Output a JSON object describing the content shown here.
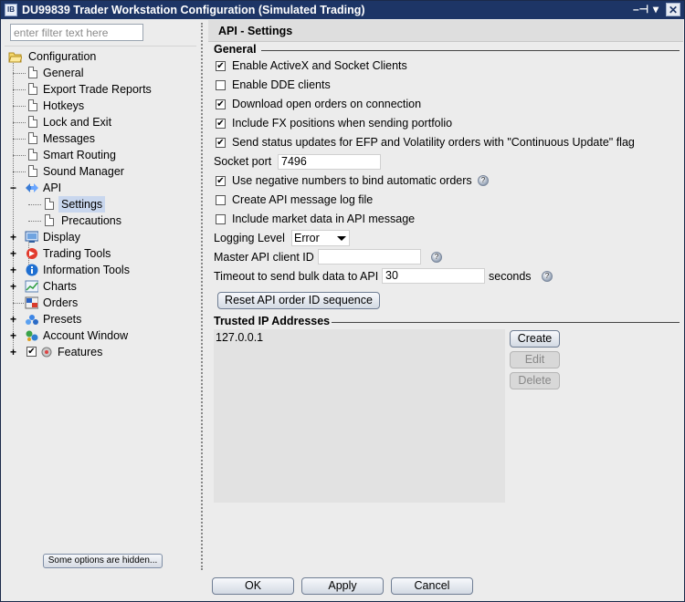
{
  "window": {
    "app_icon": "IB",
    "title": "DU99839 Trader Workstation Configuration (Simulated Trading)",
    "controls": {
      "pin": "–⊣",
      "menu": "▾",
      "close": "✕"
    }
  },
  "sidebar": {
    "filter_placeholder": "enter filter text here",
    "tree": {
      "root": "Configuration",
      "items": [
        {
          "label": "General"
        },
        {
          "label": "Export Trade Reports"
        },
        {
          "label": "Hotkeys"
        },
        {
          "label": "Lock and Exit"
        },
        {
          "label": "Messages"
        },
        {
          "label": "Smart Routing"
        },
        {
          "label": "Sound Manager"
        }
      ],
      "api": {
        "label": "API",
        "children": [
          "Settings",
          "Precautions"
        ],
        "selected": "Settings"
      },
      "groups": [
        {
          "label": "Display",
          "icon": "display-icon"
        },
        {
          "label": "Trading Tools",
          "icon": "trading-tools-icon"
        },
        {
          "label": "Information Tools",
          "icon": "info-icon"
        },
        {
          "label": "Charts",
          "icon": "chart-icon"
        },
        {
          "label": "Orders",
          "icon": "orders-icon"
        },
        {
          "label": "Presets",
          "icon": "presets-icon"
        },
        {
          "label": "Account Window",
          "icon": "account-window-icon"
        },
        {
          "label": "Features",
          "icon": "features-icon"
        }
      ]
    },
    "hidden_options_button": "Some options are hidden..."
  },
  "main": {
    "header": "API - Settings",
    "general": {
      "title": "General",
      "options": [
        {
          "label": "Enable ActiveX and Socket Clients",
          "checked": true
        },
        {
          "label": "Enable DDE clients",
          "checked": false
        },
        {
          "label": "Download open orders on connection",
          "checked": true
        },
        {
          "label": "Include FX positions when sending portfolio",
          "checked": true
        },
        {
          "label": "Send status updates for EFP and Volatility orders with \"Continuous Update\" flag",
          "checked": true
        }
      ],
      "socket_port_label": "Socket port",
      "socket_port_value": "7496",
      "options2": [
        {
          "label": "Use negative numbers to bind automatic orders",
          "checked": true
        },
        {
          "label": "Create API message log file",
          "checked": false
        },
        {
          "label": "Include market data in API message",
          "checked": false
        }
      ],
      "logging_level_label": "Logging Level",
      "logging_level_value": "Error",
      "master_client_label": "Master API client ID",
      "master_client_value": "",
      "timeout_label": "Timeout to send bulk data to API",
      "timeout_value": "30",
      "timeout_unit": "seconds",
      "reset_button": "Reset API order ID sequence"
    },
    "trusted_ips": {
      "title": "Trusted IP Addresses",
      "items": [
        "127.0.0.1"
      ],
      "create": "Create",
      "edit": "Edit",
      "delete": "Delete"
    }
  },
  "footer": {
    "ok": "OK",
    "apply": "Apply",
    "cancel": "Cancel"
  },
  "colors": {
    "titlebar": "#1d3566",
    "selection": "#c9d7ee",
    "panel": "#ececec"
  }
}
